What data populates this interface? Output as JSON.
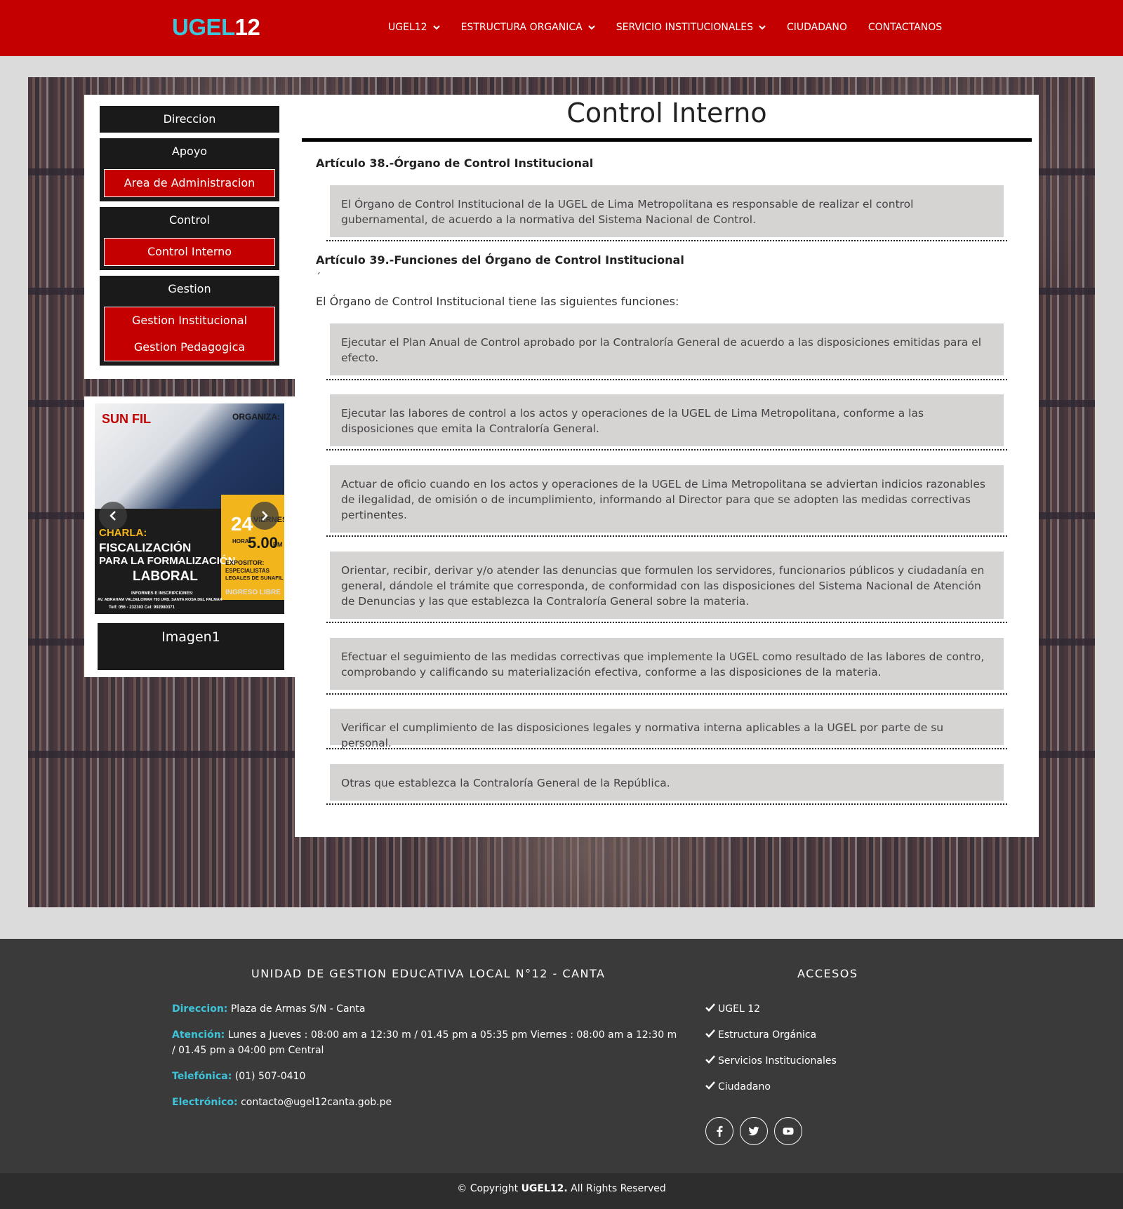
{
  "header": {
    "logo_part1": "UGEL",
    "logo_part2": "12",
    "nav": [
      {
        "label": "UGEL12"
      },
      {
        "label": "ESTRUCTURA ORGANICA"
      },
      {
        "label": "SERVICIO INSTITUCIONALES"
      },
      {
        "label": "CIUDADANO"
      },
      {
        "label": "CONTACTANOS"
      }
    ]
  },
  "sidebar": {
    "direccion": "Direccion",
    "apoyo": "Apoyo",
    "area_admin": "Area de Administracion",
    "control": "Control",
    "control_interno": "Control Interno",
    "gestion": "Gestion",
    "gestion_institucional": "Gestion Institucional",
    "gestion_pedagogica": "Gestion Pedagogica",
    "carousel_caption": "Imagen1"
  },
  "poster": {
    "brand": "SUN FIL",
    "organiza": "ORGANIZA:",
    "charla": "CHARLA:",
    "line1": "FISCALIZACIÓN",
    "line2": "PARA LA FORMALIZACIÓN",
    "line3": "LABORAL",
    "day": "24",
    "weekday": "VIERNES",
    "hora_label": "HORA:",
    "hora": "5.00",
    "pm": "PM",
    "expositor": "EXPOSITOR:",
    "especialistas": "ESPECIALISTAS",
    "legales": "LEGALES DE SUNAFIL",
    "ingreso": "INGRESO LIBRE",
    "informes": "INFORMES E INSCRIPCIONES:",
    "address": "AV. ABRAHAM VALDELOMAR 793 URB. SANTA ROSA DEL PALMAR",
    "contacts": "Telf: 056 - 232303   Cel: 992980371"
  },
  "main": {
    "title": "Control Interno",
    "art38_heading": "Artículo 38.-Órgano de Control Institucional",
    "art38_text": "El Órgano de Control Institucional de la UGEL de Lima Metropolitana es responsable de realizar el control gubernamental, de acuerdo a la normativa del Sistema Nacional de Control.",
    "art39_heading": "Artículo 39.-Funciones del Órgano de Control Institucional",
    "stray_mark": "´",
    "intro": "El Órgano de Control Institucional tiene las siguientes funciones:",
    "functions": [
      "Ejecutar el Plan Anual de Control aprobado por la Contraloría General de acuerdo a las disposiciones emitidas para el efecto.",
      "Ejecutar las labores de control a los actos y operaciones de la UGEL de Lima Metropolitana, conforme a las disposiciones que emita la Contraloría General.",
      "Actuar de oficio cuando en los actos y operaciones de la UGEL de Lima Metropolitana se adviertan indicios razonables de ilegalidad, de omisión o de incumplimiento, informando al Director para que se adopten las medidas correctivas pertinentes.",
      "Orientar, recibir, derivar y/o atender las denuncias que formulen los servidores, funcionarios públicos y ciudadanía en general, dándole el trámite que corresponda, de conformidad con las disposiciones del Sistema Nacional de Atención de Denuncias y las que establezca la Contraloría General sobre la materia.",
      "Efectuar el seguimiento de las medidas correctivas que implemente la UGEL como resultado de las labores de contro, comprobando y calificando su materialización efectiva, conforme a las disposiciones de la materia.",
      "Verificar el cumplimiento de las disposiciones legales y normativa interna aplicables a la UGEL por parte de su personal.",
      "Otras que establezca la Contraloría General de la República."
    ]
  },
  "footer": {
    "heading_left": "UNIDAD DE GESTION EDUCATIVA LOCAL N°12 - CANTA",
    "heading_right": "ACCESOS",
    "direccion_label": "Direccion:",
    "direccion_value": " Plaza de Armas S/N - Canta",
    "atencion_label": "Atención:",
    "atencion_value": " Lunes a Jueves : 08:00 am a 12:30 m / 01.45 pm a 05:35 pm Viernes : 08:00 am a 12:30 m / 01.45 pm a 04:00 pm Central",
    "telefonica_label": "Telefónica:",
    "telefonica_value": " (01) 507-0410",
    "electronico_label": "Electrónico:",
    "electronico_value": " contacto@ugel12canta.gob.pe",
    "accesos": [
      "UGEL 12",
      "Estructura Orgánica",
      "Servicios Institucionales",
      "Ciudadano"
    ],
    "copyright_prefix": "© Copyright ",
    "copyright_brand": "UGEL12.",
    "copyright_suffix": " All Rights Reserved"
  },
  "colors": {
    "brand_red": "#c50000",
    "accent_cyan": "#3ec3d9",
    "footer_bg": "#3a3a3a",
    "item_bg": "#d6d3d3"
  },
  "icons": [
    "chevron-down-icon",
    "chevron-left-icon",
    "chevron-right-icon",
    "check-icon",
    "facebook-icon",
    "twitter-icon",
    "youtube-icon"
  ]
}
